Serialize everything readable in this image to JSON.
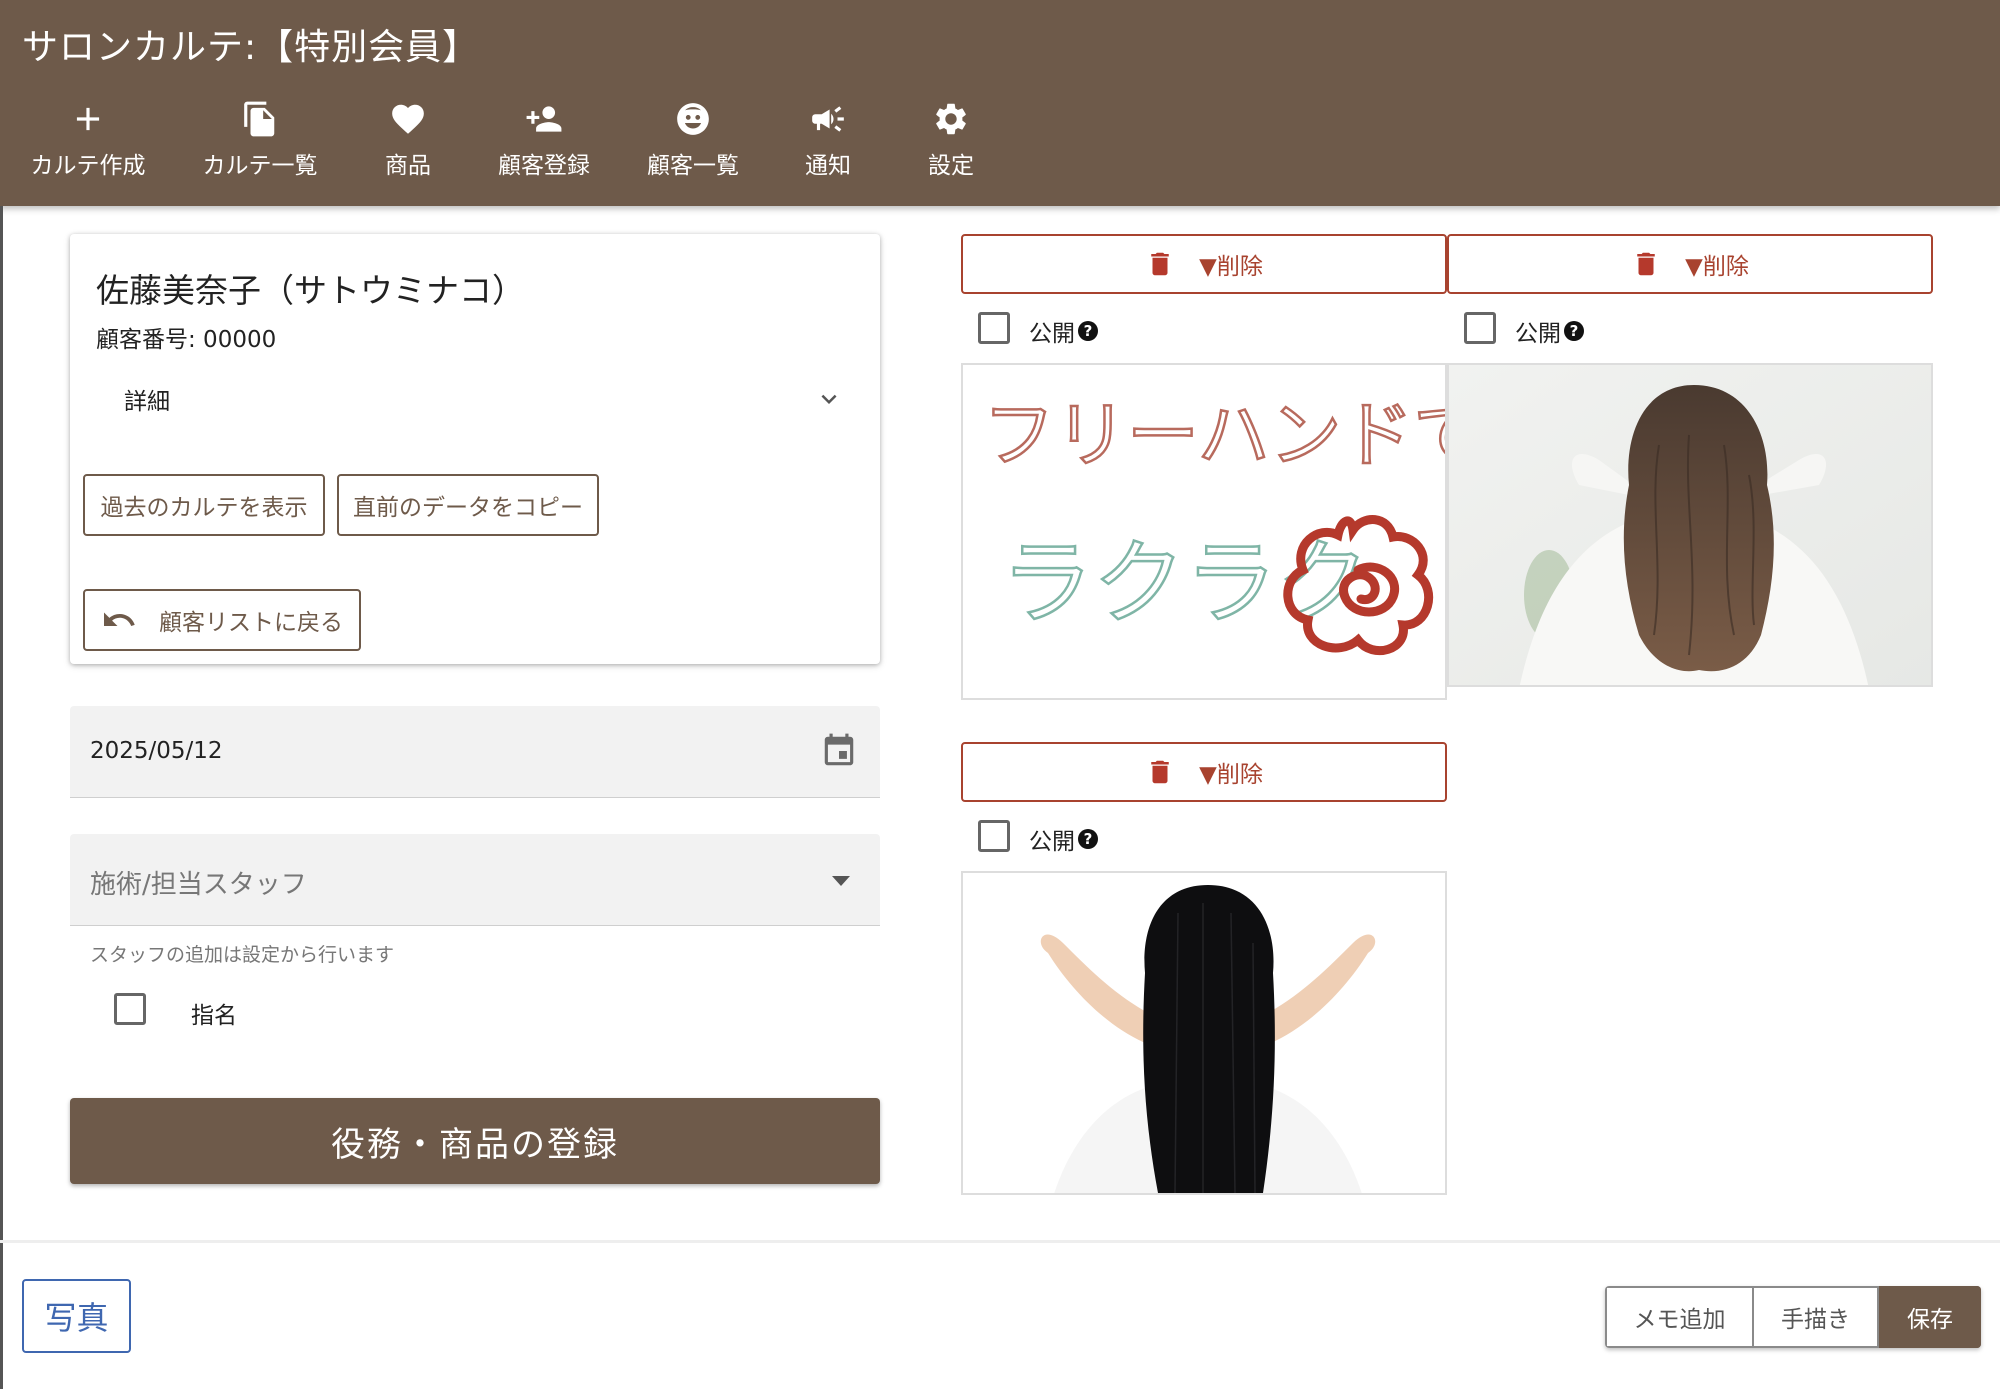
{
  "app": {
    "title": "サロンカルテ:【特別会員】"
  },
  "nav": [
    {
      "label": "カルテ作成",
      "icon": "plus-icon"
    },
    {
      "label": "カルテ一覧",
      "icon": "copy-icon"
    },
    {
      "label": "商品",
      "icon": "heart-icon"
    },
    {
      "label": "顧客登録",
      "icon": "person-add-icon"
    },
    {
      "label": "顧客一覧",
      "icon": "face-icon"
    },
    {
      "label": "通知",
      "icon": "megaphone-icon"
    },
    {
      "label": "設定",
      "icon": "gear-icon"
    }
  ],
  "customer": {
    "name": "佐藤美奈子（サトウミナコ）",
    "number_label": "顧客番号: 00000",
    "detail_label": "詳細",
    "past_btn": "過去のカルテを表示",
    "copy_btn": "直前のデータをコピー",
    "back_btn": "顧客リストに戻る"
  },
  "form": {
    "date_value": "2025/05/12",
    "staff_placeholder": "施術/担当スタッフ",
    "staff_hint": "スタッフの追加は設定から行います",
    "nominate_label": "指名",
    "nominate_checked": false,
    "register_btn": "役務・商品の登録"
  },
  "photos": [
    {
      "delete_label": "▼削除",
      "public_label": "公開",
      "public_checked": false,
      "content": "handwritten-memo",
      "handwriting": [
        "フリーハンドで",
        "ラクラク"
      ]
    },
    {
      "delete_label": "▼削除",
      "public_label": "公開",
      "public_checked": false,
      "content": "wavy-brown-hair-photo"
    },
    {
      "delete_label": "▼削除",
      "public_label": "公開",
      "public_checked": false,
      "content": "straight-black-hair-photo"
    }
  ],
  "bottom": {
    "photo_btn": "写真",
    "memo_btn": "メモ追加",
    "draw_btn": "手描き",
    "save_btn": "保存"
  },
  "colors": {
    "brand": "#6e5a4a",
    "danger": "#a8432f",
    "link": "#3f67b0"
  }
}
